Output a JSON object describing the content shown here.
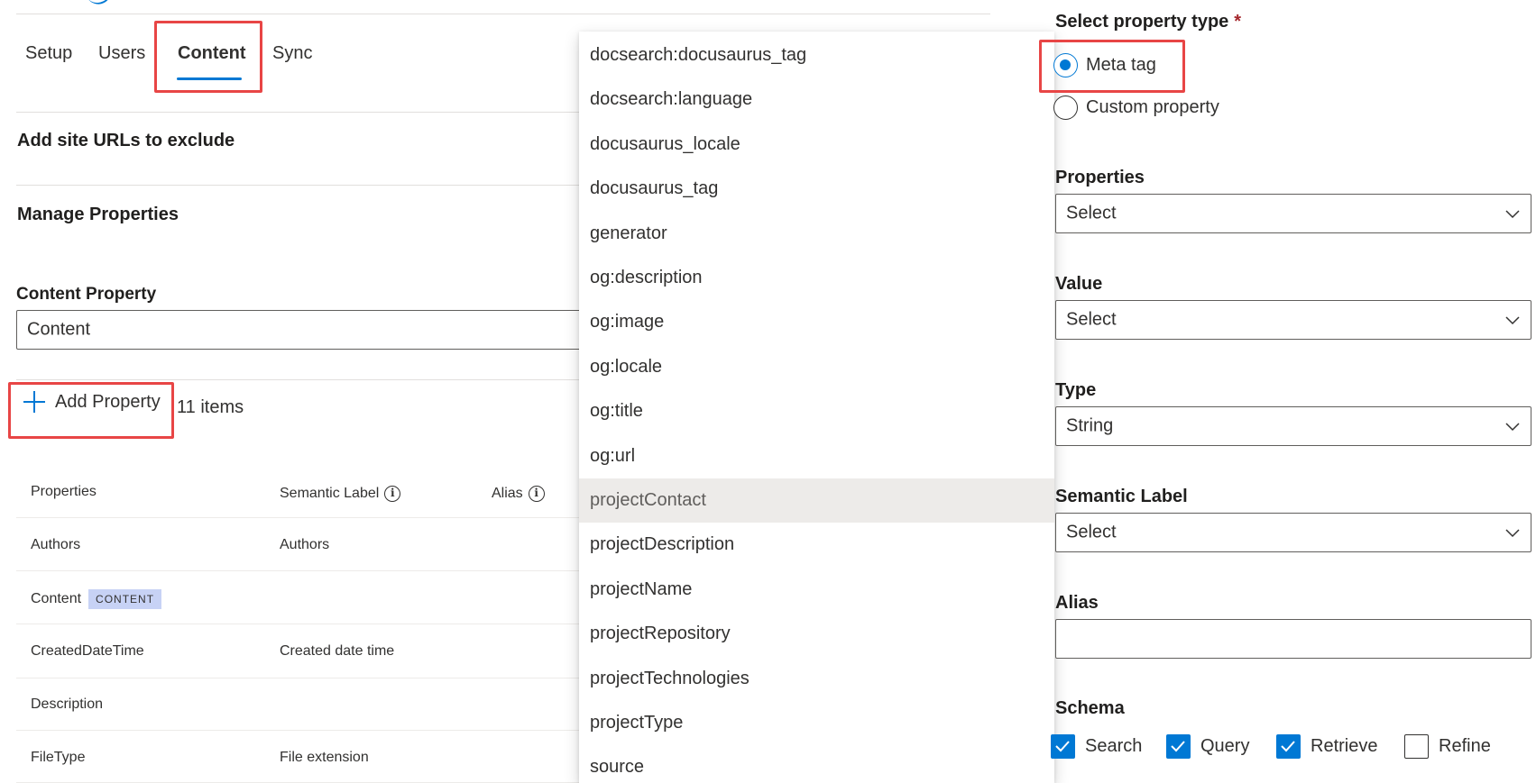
{
  "tabs": [
    {
      "label": "Setup"
    },
    {
      "label": "Users"
    },
    {
      "label": "Content"
    },
    {
      "label": "Sync"
    }
  ],
  "sections": {
    "exclude_urls": "Add site URLs to exclude",
    "manage_properties": "Manage Properties",
    "content_property_label": "Content Property",
    "content_property_value": "Content"
  },
  "toolbar": {
    "add_property_label": "Add Property",
    "item_count": "11 items"
  },
  "table": {
    "columns": [
      "Properties",
      "Semantic Label",
      "Alias"
    ],
    "rows": [
      {
        "property": "Authors",
        "semantic_label": "Authors"
      },
      {
        "property": "Content",
        "badge": "CONTENT",
        "semantic_label": ""
      },
      {
        "property": "CreatedDateTime",
        "semantic_label": "Created date time"
      },
      {
        "property": "Description",
        "semantic_label": ""
      },
      {
        "property": "FileType",
        "semantic_label": "File extension"
      }
    ]
  },
  "dropdown": {
    "items": [
      "docsearch:docusaurus_tag",
      "docsearch:language",
      "docusaurus_locale",
      "docusaurus_tag",
      "generator",
      "og:description",
      "og:image",
      "og:locale",
      "og:title",
      "og:url",
      "projectContact",
      "projectDescription",
      "projectName",
      "projectRepository",
      "projectTechnologies",
      "projectType",
      "source"
    ],
    "hovered_item": "projectContact"
  },
  "form": {
    "property_type_label": "Select property type",
    "required_marker": "*",
    "radio_options": [
      "Meta tag",
      "Custom property"
    ],
    "selected_radio": "Meta tag",
    "properties_label": "Properties",
    "properties_value": "Select",
    "value_label": "Value",
    "value_value": "Select",
    "type_label": "Type",
    "type_value": "String",
    "semantic_label_label": "Semantic Label",
    "semantic_label_value": "Select",
    "alias_label": "Alias",
    "alias_value": "",
    "schema_label": "Schema",
    "schema_options": [
      {
        "label": "Search",
        "checked": true
      },
      {
        "label": "Query",
        "checked": true
      },
      {
        "label": "Retrieve",
        "checked": true
      },
      {
        "label": "Refine",
        "checked": false
      }
    ]
  },
  "colors": {
    "accent": "#0078d4",
    "highlight": "#e84545",
    "badge_bg": "#c7d2f5",
    "hover_bg": "#edebe9"
  },
  "icons": [
    "plus-icon",
    "info-icon",
    "chevron-down-icon",
    "checkmark-icon",
    "radio-icon"
  ]
}
